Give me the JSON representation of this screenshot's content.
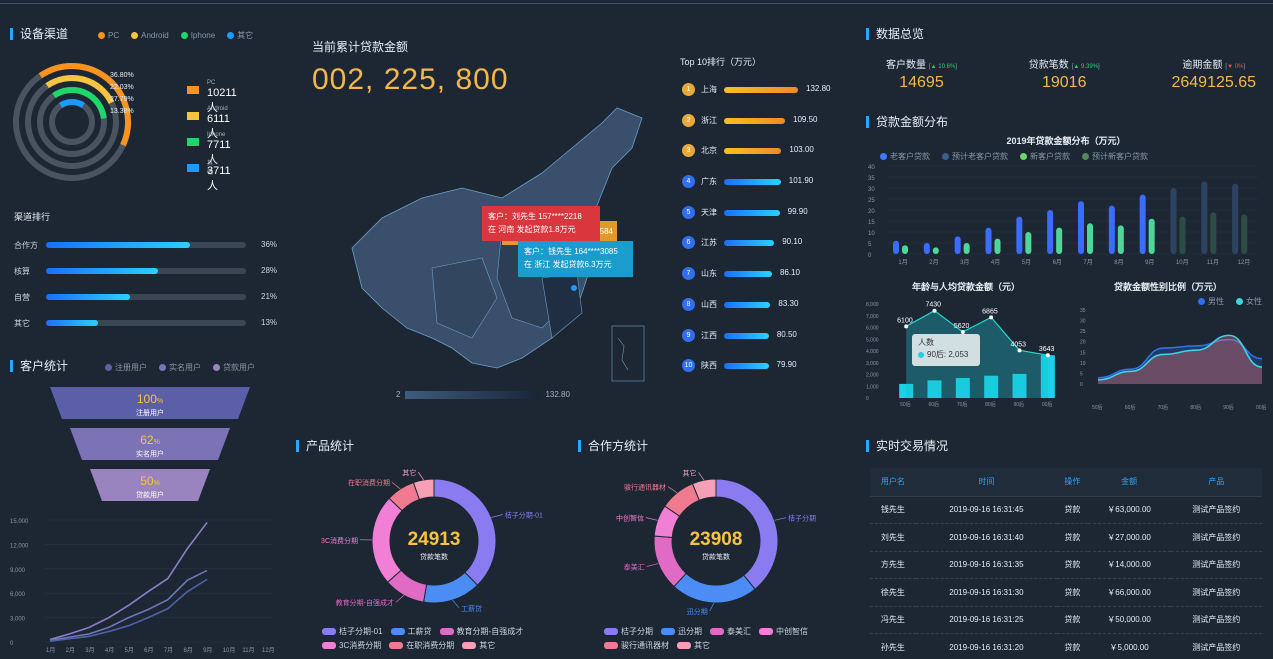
{
  "device": {
    "title": "设备渠道",
    "legend": [
      {
        "label": "PC",
        "color": "#f7931e"
      },
      {
        "label": "Android",
        "color": "#f6c342"
      },
      {
        "label": "Iphone",
        "color": "#1fd66b"
      },
      {
        "label": "其它",
        "color": "#1b9bff"
      }
    ],
    "rings": [
      {
        "pct": 0.368,
        "label": "36.80%",
        "color": "#f7931e"
      },
      {
        "pct": 0.2203,
        "label": "22.03%",
        "color": "#f6c342"
      },
      {
        "pct": 0.2779,
        "label": "27.79%",
        "color": "#1fd66b"
      },
      {
        "pct": 0.1338,
        "label": "13.38%",
        "color": "#1b9bff"
      }
    ],
    "items": [
      {
        "name": "PC",
        "value": "10211 人",
        "color": "#f7931e"
      },
      {
        "name": "Android",
        "value": "6111 人",
        "color": "#f6c342"
      },
      {
        "name": "Iphone",
        "value": "7711 人",
        "color": "#1fd66b"
      },
      {
        "name": "其他",
        "value": "3711 人",
        "color": "#1b9bff"
      }
    ]
  },
  "channel_rank": {
    "title": "渠道排行",
    "items": [
      {
        "name": "合作方",
        "pct": 36,
        "label": "36%"
      },
      {
        "name": "核算",
        "pct": 28,
        "label": "28%"
      },
      {
        "name": "自营",
        "pct": 21,
        "label": "21%"
      },
      {
        "name": "其它",
        "pct": 13,
        "label": "13%"
      }
    ]
  },
  "customer": {
    "title": "客户统计",
    "legend": [
      {
        "label": "注册用户",
        "color": "#5b5fa8"
      },
      {
        "label": "实名用户",
        "color": "#7a72b8"
      },
      {
        "label": "贷款用户",
        "color": "#9a84c2"
      }
    ],
    "funnel": [
      {
        "pct": "100",
        "label": "注册用户",
        "color": "#5b5fa8"
      },
      {
        "pct": "62",
        "label": "实名用户",
        "color": "#7b73b5"
      },
      {
        "pct": "50",
        "label": "贷款用户",
        "color": "#9a84c0"
      }
    ],
    "y_ticks": [
      "15,000",
      "12,000",
      "9,000",
      "6,000",
      "3,000",
      "0"
    ],
    "x_ticks": [
      "1月",
      "2月",
      "3月",
      "4月",
      "5月",
      "6月",
      "7月",
      "8月",
      "9月",
      "10月",
      "11月",
      "12月"
    ]
  },
  "loan_total": {
    "label": "当前累计贷款金额",
    "value": "002, 225, 800",
    "legend_min": "2",
    "legend_max": "132.80",
    "popups": [
      {
        "line1": "客户：刘先生  157****2218",
        "line2": "在 河南 发起贷款1.8万元"
      },
      {
        "line1": "客户：钱先生  164****3085",
        "line2": "在 浙江 发起贷款6.3万元"
      }
    ],
    "popup_fragment": "584"
  },
  "top10": {
    "title": "Top 10排行（万元）",
    "items": [
      {
        "rank": "1",
        "name": "上海",
        "value": "132.80",
        "num": 132.8
      },
      {
        "rank": "2",
        "name": "浙江",
        "value": "109.50",
        "num": 109.5
      },
      {
        "rank": "3",
        "name": "北京",
        "value": "103.00",
        "num": 103.0
      },
      {
        "rank": "4",
        "name": "广东",
        "value": "101.90",
        "num": 101.9
      },
      {
        "rank": "5",
        "name": "天津",
        "value": "99.90",
        "num": 99.9
      },
      {
        "rank": "6",
        "name": "江苏",
        "value": "90.10",
        "num": 90.1
      },
      {
        "rank": "7",
        "name": "山东",
        "value": "86.10",
        "num": 86.1
      },
      {
        "rank": "8",
        "name": "山西",
        "value": "83.30",
        "num": 83.3
      },
      {
        "rank": "9",
        "name": "江西",
        "value": "80.50",
        "num": 80.5
      },
      {
        "rank": "10",
        "name": "陕西",
        "value": "79.90",
        "num": 79.9
      }
    ]
  },
  "overview": {
    "title": "数据总览",
    "kpis": [
      {
        "label": "客户数量",
        "change": "▲ 10.6%",
        "value": "14695"
      },
      {
        "label": "贷款笔数",
        "change": "▲ 9.39%",
        "value": "19016"
      },
      {
        "label": "逾期金额",
        "change": "▼ 0%",
        "value": "2649125.65"
      }
    ]
  },
  "loan_dist": {
    "title": "贷款金额分布",
    "chart_title": "2019年贷款金额分布（万元）",
    "legend": [
      {
        "label": "老客户贷款",
        "color": "#3b7bff"
      },
      {
        "label": "预计老客户贷款",
        "color": "#3b5f8e"
      },
      {
        "label": "新客户贷款",
        "color": "#6fd66b"
      },
      {
        "label": "预计新客户贷款",
        "color": "#4e8a5a"
      }
    ],
    "y_ticks": [
      "40",
      "35",
      "30",
      "25",
      "20",
      "15",
      "10",
      "5",
      "0"
    ]
  },
  "chart_data": [
    {
      "type": "bar",
      "title": "2019年贷款金额分布（万元）",
      "categories": [
        "1月",
        "2月",
        "3月",
        "4月",
        "5月",
        "6月",
        "7月",
        "8月",
        "9月",
        "10月",
        "11月",
        "12月"
      ],
      "ylim": [
        0,
        40
      ],
      "series": [
        {
          "name": "老客户贷款",
          "values": [
            6,
            5,
            8,
            12,
            17,
            20,
            24,
            22,
            27,
            null,
            null,
            null
          ]
        },
        {
          "name": "预计老客户贷款",
          "values": [
            null,
            null,
            null,
            null,
            null,
            null,
            null,
            null,
            null,
            30,
            33,
            32
          ]
        },
        {
          "name": "新客户贷款",
          "values": [
            4,
            3,
            5,
            7,
            10,
            12,
            14,
            13,
            16,
            null,
            null,
            null
          ]
        },
        {
          "name": "预计新客户贷款",
          "values": [
            null,
            null,
            null,
            null,
            null,
            null,
            null,
            null,
            null,
            17,
            19,
            18
          ]
        }
      ]
    },
    {
      "type": "bar",
      "title": "年龄与人均贷款金额（元）",
      "categories": [
        "50后",
        "60后",
        "70后",
        "80后",
        "90后",
        "00后"
      ],
      "ylim": [
        0,
        8000
      ],
      "series": [
        {
          "name": "人数",
          "values": [
            1200,
            1500,
            1700,
            1900,
            2053,
            3643
          ]
        }
      ],
      "line_values": [
        6100,
        7430,
        5620,
        6865,
        4053,
        3643
      ],
      "y_ticks": [
        "8,000",
        "7,000",
        "6,000",
        "5,000",
        "4,000",
        "3,000",
        "2,000",
        "1,000",
        "0"
      ],
      "tooltip": {
        "title": "人数",
        "text": "90后: 2,053"
      }
    },
    {
      "type": "area",
      "title": "贷款金额性别比例（万元）",
      "categories": [
        "50后",
        "60后",
        "70后",
        "80后",
        "90后",
        "00后"
      ],
      "ylim": [
        0,
        35
      ],
      "y_ticks": [
        "35",
        "30",
        "25",
        "20",
        "15",
        "10",
        "5",
        "0"
      ],
      "series": [
        {
          "name": "男性",
          "values": [
            3,
            7,
            17,
            18,
            21,
            12
          ]
        },
        {
          "name": "女性",
          "values": [
            2,
            6,
            14,
            16,
            23,
            8
          ]
        }
      ]
    },
    {
      "type": "pie",
      "title": "产品统计",
      "center_value": "24913",
      "center_label": "贷款笔数",
      "slices": [
        {
          "label": "桔子分期-01",
          "value": 35,
          "color": "#8a7cf0"
        },
        {
          "label": "工薪贷",
          "value": 14,
          "color": "#4b8cf5"
        },
        {
          "label": "教育分期-自强成才",
          "value": 10,
          "color": "#e06bc5"
        },
        {
          "label": "3C消费分期",
          "value": 22,
          "color": "#f27fd6"
        },
        {
          "label": "在职消费分期",
          "value": 7,
          "color": "#f07a8f"
        },
        {
          "label": "其它",
          "value": 5,
          "color": "#f5a0b5"
        }
      ]
    },
    {
      "type": "pie",
      "title": "合作方统计",
      "center_value": "23908",
      "center_label": "贷款笔数",
      "slices": [
        {
          "label": "桔子分期",
          "value": 38,
          "color": "#8a7cf0"
        },
        {
          "label": "迅分期",
          "value": 22,
          "color": "#4b8cf5"
        },
        {
          "label": "泰美汇",
          "value": 14,
          "color": "#e06bc5"
        },
        {
          "label": "中创智信",
          "value": 8,
          "color": "#f27fd6"
        },
        {
          "label": "骏行通讯器材",
          "value": 9,
          "color": "#f07a8f"
        },
        {
          "label": "其它",
          "value": 6,
          "color": "#f5a0b5"
        }
      ]
    },
    {
      "type": "line",
      "title": "客户统计",
      "categories": [
        "1月",
        "2月",
        "3月",
        "4月",
        "5月",
        "6月",
        "7月",
        "8月",
        "9月",
        "10月",
        "11月",
        "12月"
      ],
      "ylim": [
        0,
        15000
      ],
      "series": [
        {
          "name": "注册用户",
          "values": [
            300,
            1000,
            1800,
            3000,
            4500,
            6200,
            7800,
            11500,
            14700
          ]
        },
        {
          "name": "实名用户",
          "values": [
            200,
            600,
            1000,
            1800,
            3000,
            4000,
            5200,
            7600,
            8800
          ]
        },
        {
          "name": "贷款用户",
          "values": [
            100,
            400,
            700,
            1300,
            2000,
            3000,
            4100,
            6200,
            7700
          ]
        }
      ]
    }
  ],
  "age_chart": {
    "title": "年龄与人均贷款金额（元）"
  },
  "gender_chart": {
    "title": "贷款金额性别比例（万元）",
    "legend": [
      {
        "label": "男性",
        "color": "#2f6ff0"
      },
      {
        "label": "女性",
        "color": "#3ad6e0"
      }
    ]
  },
  "product": {
    "title": "产品统计"
  },
  "partner": {
    "title": "合作方统计"
  },
  "trades": {
    "title": "实时交易情况",
    "columns": [
      "用户名",
      "时间",
      "操作",
      "金额",
      "产品"
    ],
    "rows": [
      [
        "钱先生",
        "2019-09-16 16:31:45",
        "贷款",
        "￥63,000.00",
        "测试产品签约"
      ],
      [
        "刘先生",
        "2019-09-16 16:31:40",
        "贷款",
        "￥27,000.00",
        "测试产品签约"
      ],
      [
        "方先生",
        "2019-09-16 16:31:35",
        "贷款",
        "￥14,000.00",
        "测试产品签约"
      ],
      [
        "徐先生",
        "2019-09-16 16:31:30",
        "贷款",
        "￥66,000.00",
        "测试产品签约"
      ],
      [
        "冯先生",
        "2019-09-16 16:31:25",
        "贷款",
        "￥50,000.00",
        "测试产品签约"
      ],
      [
        "孙先生",
        "2019-09-16 16:31:20",
        "贷款",
        "￥5,000.00",
        "测试产品签约"
      ]
    ]
  }
}
